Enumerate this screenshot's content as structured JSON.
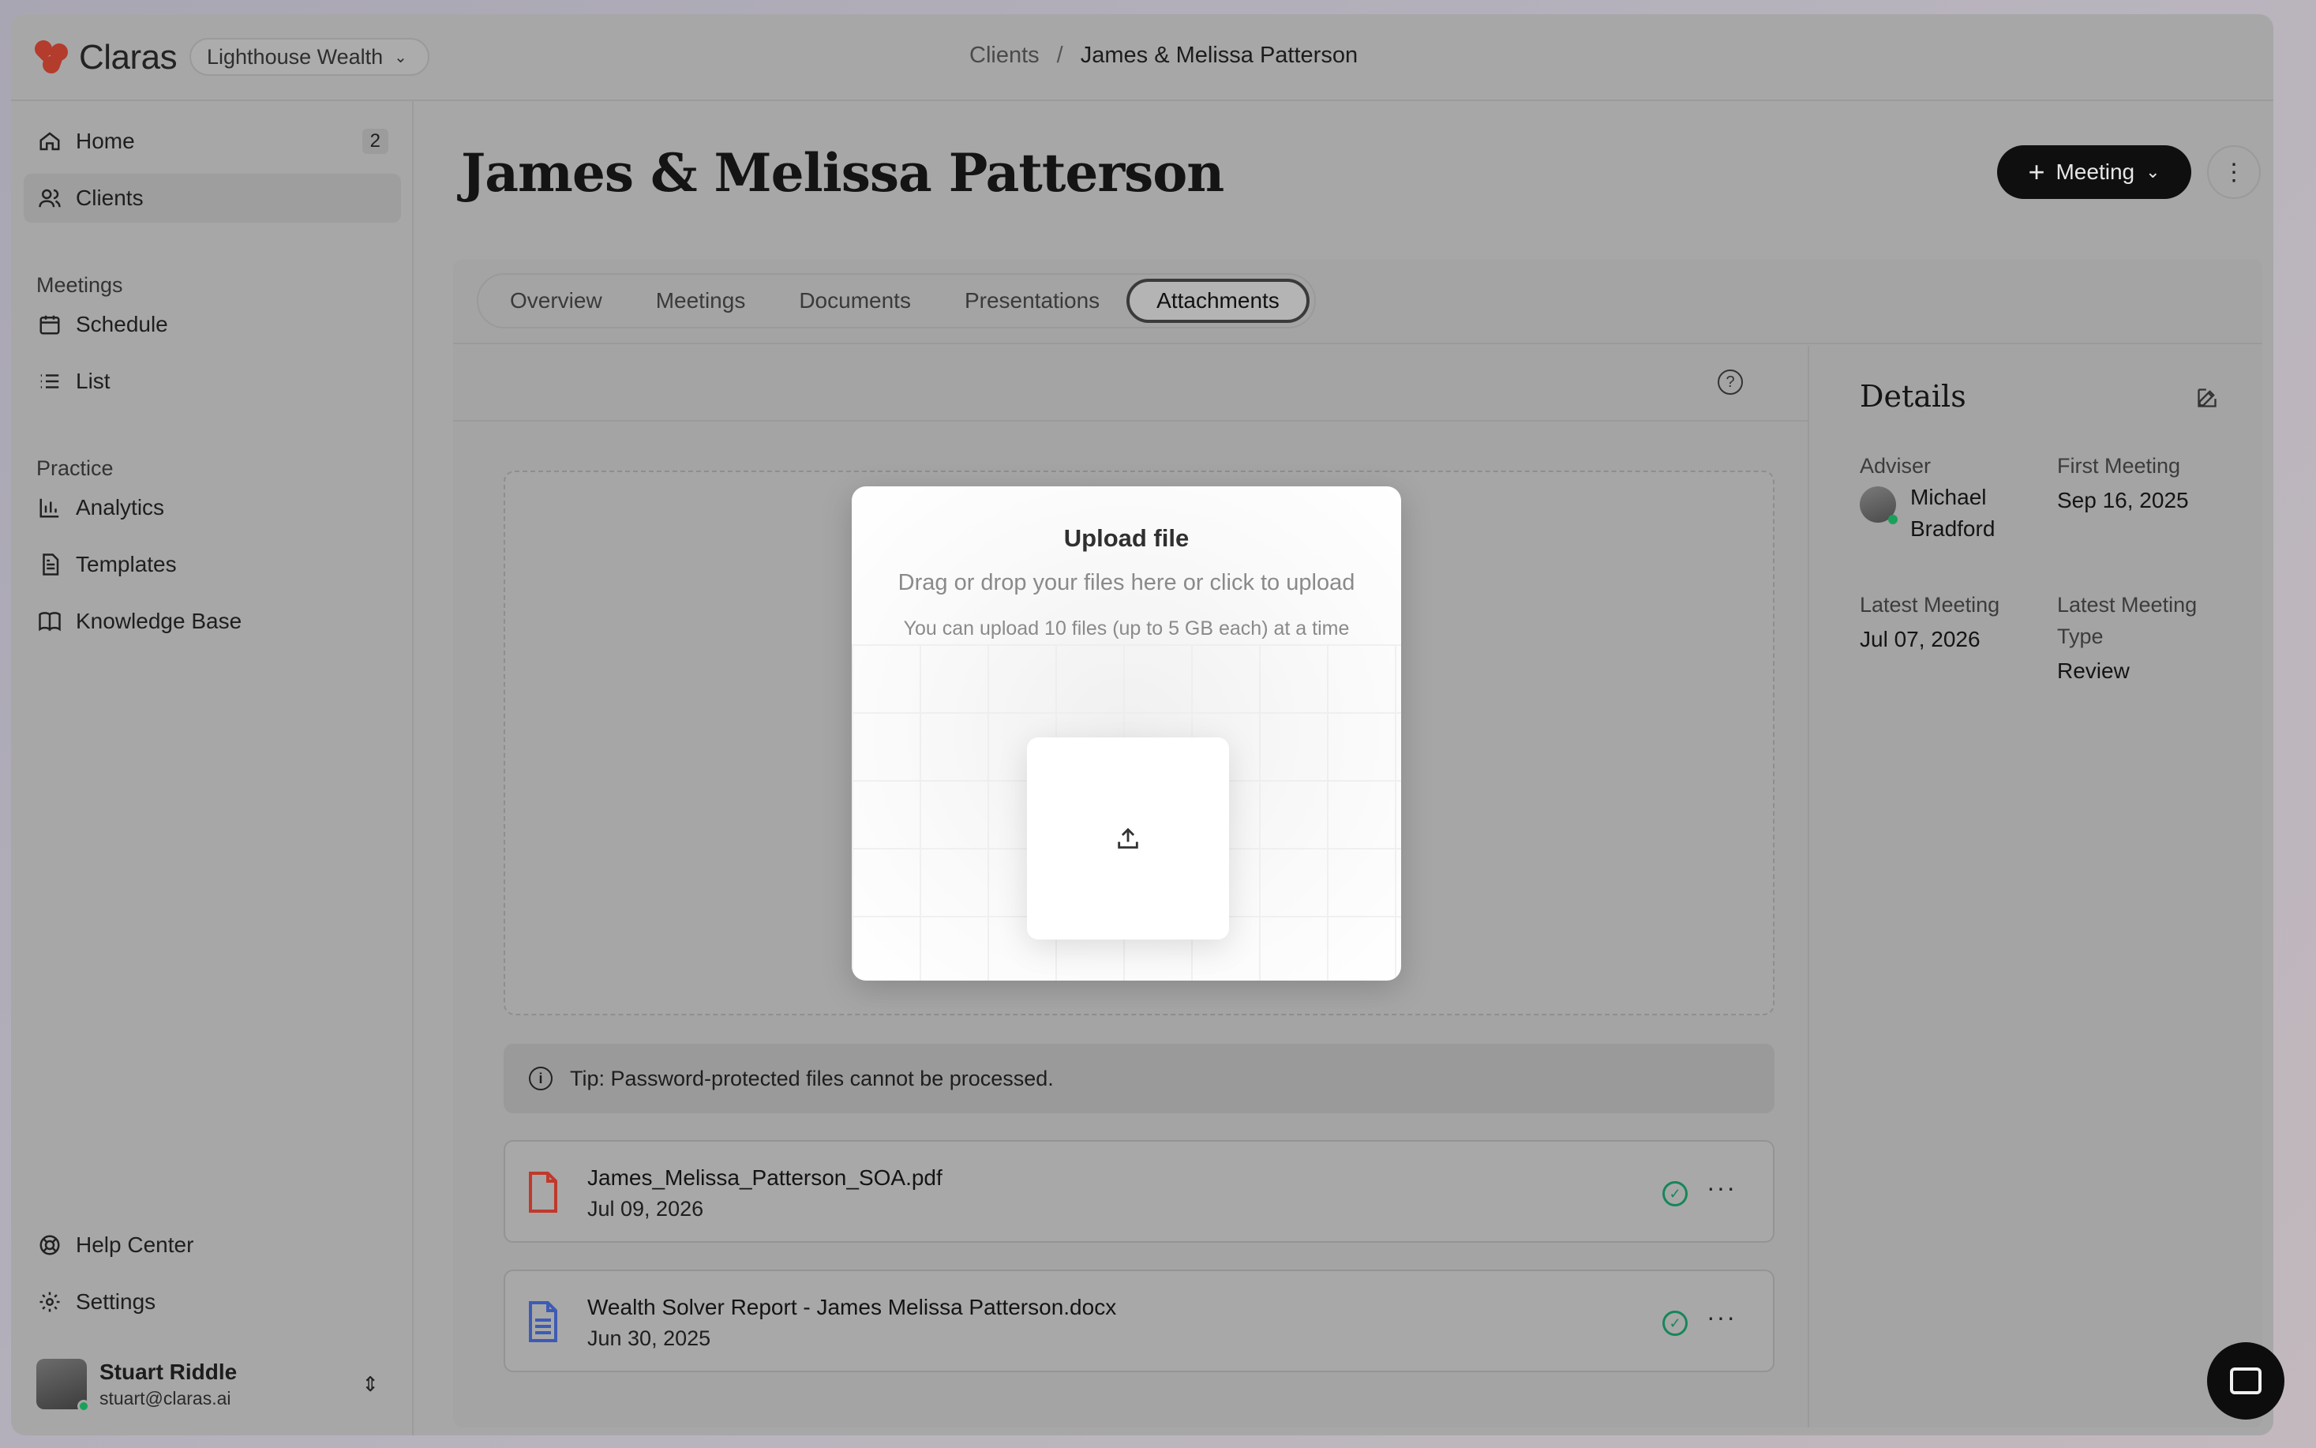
{
  "app": {
    "brand": "Claras",
    "org_selector": "Lighthouse Wealth"
  },
  "breadcrumb": {
    "parent": "Clients",
    "separator": "/",
    "current": "James & Melissa Patterson"
  },
  "sidebar": {
    "home": {
      "label": "Home",
      "badge": "2"
    },
    "clients": {
      "label": "Clients"
    },
    "meetings_section": "Meetings",
    "schedule": {
      "label": "Schedule"
    },
    "list": {
      "label": "List"
    },
    "practice_section": "Practice",
    "analytics": {
      "label": "Analytics"
    },
    "templates": {
      "label": "Templates"
    },
    "knowledge_base": {
      "label": "Knowledge Base"
    },
    "help_center": {
      "label": "Help Center"
    },
    "settings": {
      "label": "Settings"
    },
    "user": {
      "name": "Stuart Riddle",
      "email": "stuart@claras.ai"
    }
  },
  "page": {
    "title": "James & Melissa Patterson",
    "meeting_button": "Meeting"
  },
  "tabs": [
    {
      "label": "Overview",
      "active": false
    },
    {
      "label": "Meetings",
      "active": false
    },
    {
      "label": "Documents",
      "active": false
    },
    {
      "label": "Presentations",
      "active": false
    },
    {
      "label": "Attachments",
      "active": true
    }
  ],
  "upload_modal": {
    "title": "Upload file",
    "subtitle": "Drag or drop your files here or click to upload",
    "note": "You can upload 10 files (up to 5 GB each) at a time"
  },
  "tip": "Tip: Password-protected files cannot be processed.",
  "files": [
    {
      "name": "James_Melissa_Patterson_SOA.pdf",
      "date": "Jul 09, 2026",
      "type": "pdf"
    },
    {
      "name": "Wealth Solver Report - James Melissa Patterson.docx",
      "date": "Jun 30, 2025",
      "type": "docx"
    }
  ],
  "details": {
    "title": "Details",
    "adviser_label": "Adviser",
    "adviser_first": "Michael",
    "adviser_last": "Bradford",
    "first_meeting_label": "First Meeting",
    "first_meeting_value": "Sep 16, 2025",
    "latest_meeting_label": "Latest Meeting",
    "latest_meeting_value": "Jul 07, 2026",
    "latest_meeting_type_label_1": "Latest Meeting",
    "latest_meeting_type_label_2": "Type",
    "latest_meeting_type_value": "Review"
  },
  "colors": {
    "brand": "#b43c2c",
    "success": "#17865a",
    "pdf_icon": "#c0392b",
    "docx_icon": "#3d5bb5",
    "primary_button": "#0f0f0f"
  }
}
